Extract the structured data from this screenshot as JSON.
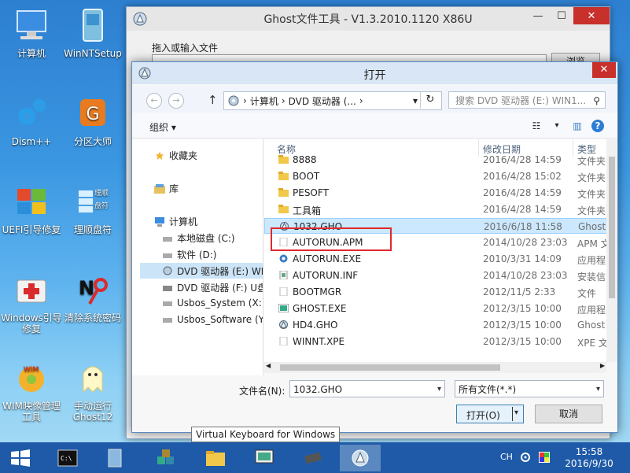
{
  "desktop": {
    "icons": [
      {
        "label": "计算机"
      },
      {
        "label": "WinNTSetup"
      },
      {
        "label": "Dism++"
      },
      {
        "label": "分区大师"
      },
      {
        "label": "UEFI引导修复"
      },
      {
        "label": "理顺盘符"
      },
      {
        "label": "Windows引导修复"
      },
      {
        "label": "清除系统密码"
      },
      {
        "label": "WIM映像管理工具"
      },
      {
        "label": "手动运行Ghost12"
      }
    ],
    "lipan_text": "理顺\n盘符"
  },
  "ghost_window": {
    "title": "Ghost文件工具 - V1.3.2010.1120 X86U",
    "drag_label": "拖入或输入文件",
    "browse_label": "浏览",
    "min_symbol": "—",
    "max_symbol": "☐",
    "close_symbol": "✕"
  },
  "open_dialog": {
    "title": "打开",
    "close_symbol": "✕",
    "back_symbol": "←",
    "forward_symbol": "→",
    "up_symbol": "↑",
    "breadcrumb": [
      "计算机",
      "DVD 驱动器 (..."
    ],
    "breadcrumb_sep": "›",
    "refresh_symbol": "↻",
    "search_placeholder": "搜索 DVD 驱动器 (E:) WIN1...",
    "search_icon_symbol": "⚲",
    "organize_label": "组织 ▾",
    "view_symbol": "☷",
    "view_dd": "▾",
    "pane_symbol": "▥",
    "help_symbol": "?",
    "nav": {
      "favorites": "收藏夹",
      "library": "库",
      "computer": "计算机",
      "drives": [
        "本地磁盘 (C:)",
        "软件 (D:)",
        "DVD 驱动器 (E:) WI",
        "DVD 驱动器 (F:) U盘",
        "Usbos_System (X:)",
        "Usbos_Software (Y"
      ]
    },
    "columns": {
      "name": "名称",
      "date": "修改日期",
      "type": "类型"
    },
    "files": [
      {
        "name": "8888",
        "date": "2016/4/28 14:59",
        "type": "文件夹",
        "kind": "folder"
      },
      {
        "name": "BOOT",
        "date": "2016/4/28 15:02",
        "type": "文件夹",
        "kind": "folder"
      },
      {
        "name": "PESOFT",
        "date": "2016/4/28 14:59",
        "type": "文件夹",
        "kind": "folder"
      },
      {
        "name": "工具箱",
        "date": "2016/4/28 14:59",
        "type": "文件夹",
        "kind": "folder"
      },
      {
        "name": "1032.GHO",
        "date": "2016/6/18 11:58",
        "type": "Ghost",
        "kind": "gho"
      },
      {
        "name": "AUTORUN.APM",
        "date": "2014/10/28 23:03",
        "type": "APM 文",
        "kind": "file"
      },
      {
        "name": "AUTORUN.EXE",
        "date": "2010/3/31 14:09",
        "type": "应用程",
        "kind": "exe"
      },
      {
        "name": "AUTORUN.INF",
        "date": "2014/10/28 23:03",
        "type": "安装信",
        "kind": "inf"
      },
      {
        "name": "BOOTMGR",
        "date": "2012/11/5 2:33",
        "type": "文件",
        "kind": "file"
      },
      {
        "name": "GHOST.EXE",
        "date": "2012/3/15 10:00",
        "type": "应用程",
        "kind": "exe2"
      },
      {
        "name": "HD4.GHO",
        "date": "2012/3/15 10:00",
        "type": "Ghost",
        "kind": "gho"
      },
      {
        "name": "WINNT.XPE",
        "date": "2012/3/15 10:00",
        "type": "XPE 文",
        "kind": "file"
      }
    ],
    "filename_label": "文件名(N):",
    "filename_value": "1032.GHO",
    "filetype_value": "所有文件(*.*)",
    "open_label": "打开(O)",
    "cancel_label": "取消",
    "dd_symbol": "▾",
    "scroll_left": "◀",
    "scroll_right": "▶"
  },
  "tooltip": "Virtual Keyboard for Windows",
  "taskbar": {
    "tray_lang": "CH",
    "clock_time": "15:58",
    "clock_date": "2016/9/30"
  }
}
